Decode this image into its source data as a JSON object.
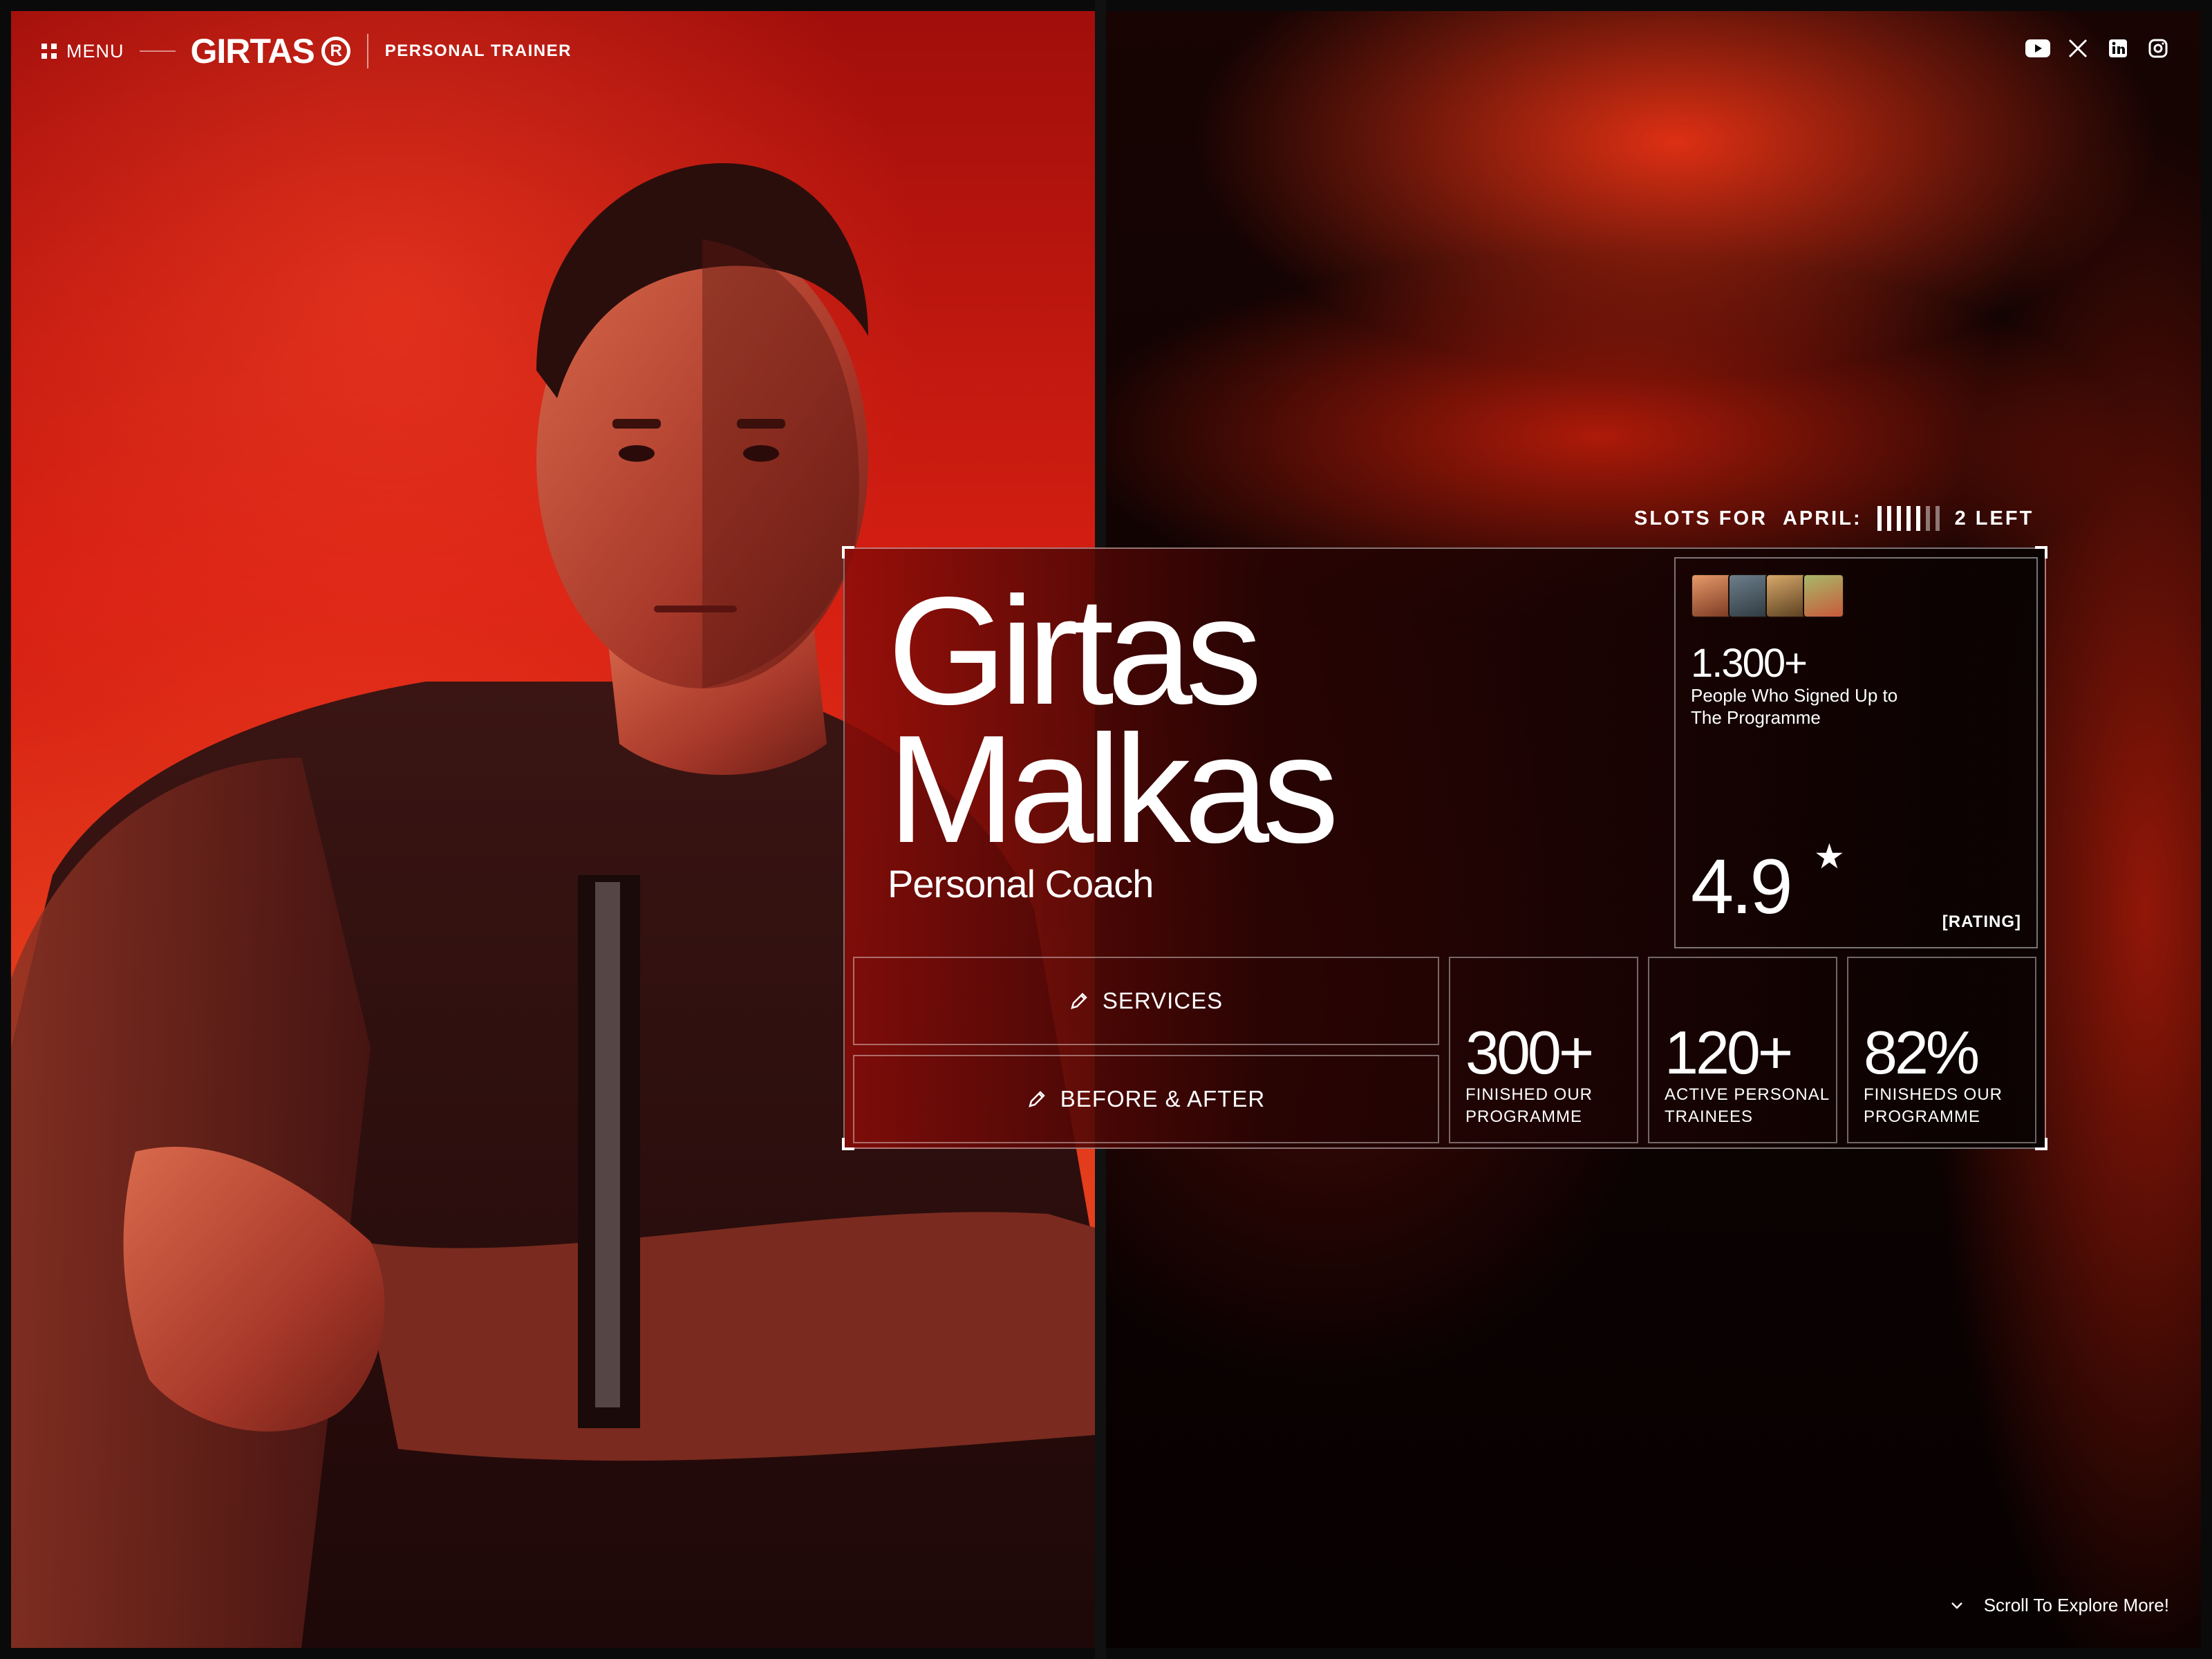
{
  "header": {
    "menu_label": "MENU",
    "brand": "GIRTAS",
    "brand_mark": "R",
    "tagline": "PERSONAL TRAINER"
  },
  "social": [
    {
      "name": "youtube-icon"
    },
    {
      "name": "x-icon"
    },
    {
      "name": "linkedin-icon"
    },
    {
      "name": "instagram-icon"
    }
  ],
  "slots": {
    "label": "SLOTS FOR",
    "month": "APRIL:",
    "remaining": "2 LEFT",
    "filled": 5,
    "total": 7
  },
  "hero": {
    "first_name": "Girtas",
    "last_name": "Malkas",
    "role": "Personal Coach"
  },
  "stats_card": {
    "people_count": "1.300+",
    "people_label": "People Who Signed Up to The Programme",
    "rating": "4.9",
    "rating_star": "★",
    "rating_label": "[RATING]"
  },
  "buttons": {
    "services": "SERVICES",
    "before_after": "BEFORE & AFTER"
  },
  "metrics": [
    {
      "value": "300+",
      "label": "FINISHED OUR PROGRAMME"
    },
    {
      "value": "120+",
      "label": "ACTIVE PERSONAL TRAINEES"
    },
    {
      "value": "82%",
      "label": "FINISHEDS OUR PROGRAMME"
    }
  ],
  "scroll_hint": "Scroll To Explore More!",
  "colors": {
    "accent": "#e0281a",
    "background": "#0a0a0a",
    "text": "#ffffff"
  }
}
